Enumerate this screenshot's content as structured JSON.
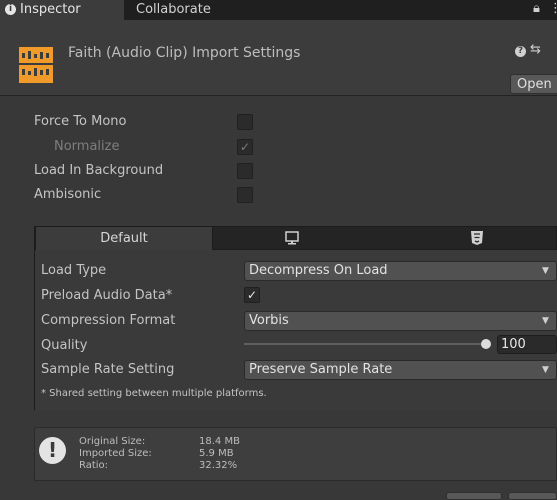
{
  "tabs": {
    "inspector": "Inspector",
    "collaborate": "Collaborate",
    "inspector_icon": "info-icon",
    "lock_icon": "lock-icon",
    "menu_icon": "kebab-menu-icon"
  },
  "header": {
    "title": "Faith (Audio Clip) Import Settings",
    "open_button": "Open",
    "asset_icon": "audio-clip-icon",
    "help_icon": "help-icon",
    "preset_icon": "preset-icon"
  },
  "settings": {
    "force_to_mono": {
      "label": "Force To Mono",
      "checked": false
    },
    "normalize": {
      "label": "Normalize",
      "checked": true,
      "disabled": true
    },
    "load_in_background": {
      "label": "Load In Background",
      "checked": false
    },
    "ambisonic": {
      "label": "Ambisonic",
      "checked": false
    }
  },
  "platform_tabs": {
    "default": "Default",
    "standalone_icon": "monitor-icon",
    "webgl_icon": "html5-icon"
  },
  "platform": {
    "load_type": {
      "label": "Load Type",
      "value": "Decompress On Load"
    },
    "preload_audio_data": {
      "label": "Preload Audio Data*",
      "checked": true
    },
    "compression_format": {
      "label": "Compression Format",
      "value": "Vorbis"
    },
    "quality": {
      "label": "Quality",
      "value": "100",
      "fraction": 1.0
    },
    "sample_rate_setting": {
      "label": "Sample Rate Setting",
      "value": "Preserve Sample Rate"
    },
    "note": "* Shared setting between multiple platforms."
  },
  "info": {
    "original_size_label": "Original Size:",
    "original_size_value": "18.4 MB",
    "imported_size_label": "Imported Size:",
    "imported_size_value": "5.9 MB",
    "ratio_label": "Ratio:",
    "ratio_value": "32.32%"
  },
  "colors": {
    "panel_bg": "#383838",
    "tab_bar": "#1f1f1f",
    "audio_icon": "#f09a2a"
  }
}
